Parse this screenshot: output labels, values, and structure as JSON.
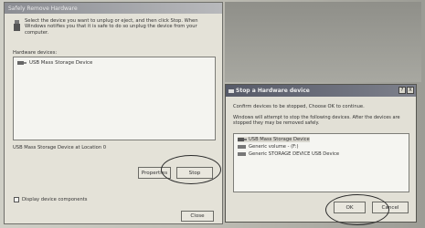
{
  "left_dialog": {
    "title": "Safely Remove Hardware",
    "instructions": "Select the device you want to unplug or eject, and then click Stop. When Windows notifies you that it is safe to do so unplug the device from your computer.",
    "hardware_label": "Hardware devices:",
    "devices": [
      "USB Mass Storage Device"
    ],
    "location_text": "USB Mass Storage Device at Location 0",
    "properties_button": "Properties",
    "stop_button": "Stop",
    "display_components_label": "Display device components",
    "display_components_checked": false,
    "close_button": "Close"
  },
  "right_dialog": {
    "title": "Stop a Hardware device",
    "help_button": "?",
    "close_button": "X",
    "confirm_text": "Confirm devices to be stopped, Choose OK to continue.",
    "windows_text": "Windows will attempt to stop the following devices. After the devices are stopped they may be removed safely.",
    "devices": [
      "USB Mass Storage Device",
      "Generic volume - (F:)",
      "Generic STORAGE DEVICE USB Device"
    ],
    "ok_button": "OK",
    "cancel_button": "Cancel"
  },
  "colors": {
    "dialog_bg": "#e4e2d8",
    "titlebar_active": "#565a68",
    "annotation": "#2b2b2b"
  }
}
